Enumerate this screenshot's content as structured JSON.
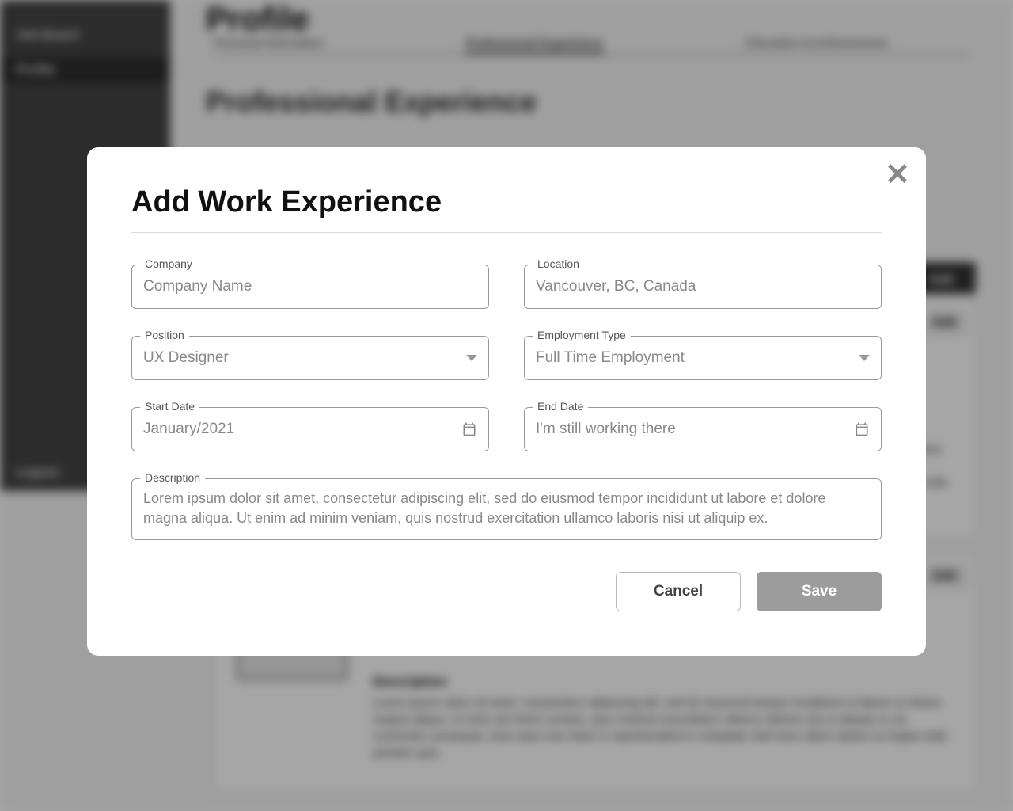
{
  "bg": {
    "sidebar": {
      "jobBoard": "Job Board",
      "profile": "Profile",
      "logout": "Logout"
    },
    "pageTitle": "Profile",
    "tabs": {
      "personal": "Personal Information",
      "professional": "Professional Experience",
      "education": "Education & Achievements"
    },
    "sectionTitle": "Professional Experience",
    "addButton": "Add",
    "card": {
      "edit": "Edit",
      "descLabel": "Description",
      "descText": "Lorem ipsum dolor sit amet, consectetur adipiscing elit, sed do eiusmod tempor incididunt ut labore et dolore magna aliqua. Ut enim ad minim veniam, quis nostrud exercitation ullamco laboris nisi ut aliquip ex ea commodo consequat. Duis aute irure dolor in reprehenderit in voluptate velit esse cillum dolore eu fugiat nulla pariatur quis."
    }
  },
  "modal": {
    "title": "Add Work Experience",
    "fields": {
      "company": {
        "label": "Company",
        "value": "Company Name"
      },
      "location": {
        "label": "Location",
        "value": "Vancouver, BC, Canada"
      },
      "position": {
        "label": "Position",
        "value": "UX Designer"
      },
      "employmentType": {
        "label": "Employment Type",
        "value": "Full Time Employment"
      },
      "startDate": {
        "label": "Start Date",
        "value": "January/2021"
      },
      "endDate": {
        "label": "End Date",
        "value": "I'm still working there"
      },
      "description": {
        "label": "Description",
        "value": "Lorem ipsum dolor sit amet, consectetur adipiscing elit, sed do eiusmod tempor incididunt ut labore et dolore magna aliqua. Ut enim ad minim veniam, quis nostrud exercitation ullamco laboris nisi ut aliquip ex."
      }
    },
    "actions": {
      "cancel": "Cancel",
      "save": "Save"
    }
  }
}
